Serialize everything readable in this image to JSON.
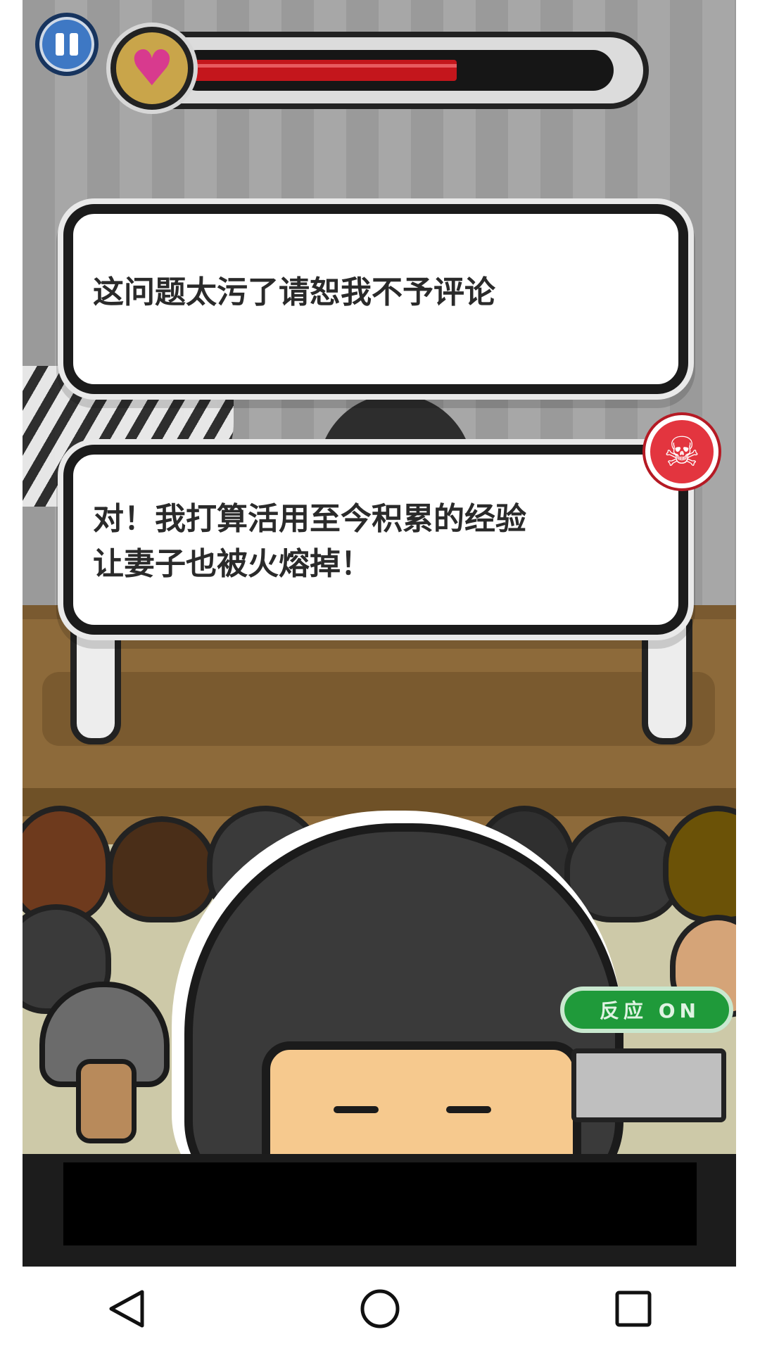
{
  "health": {
    "fraction": 0.64,
    "icon": "heart-icon",
    "color": "#c4161c"
  },
  "dialogue": {
    "options": [
      {
        "text": "这问题太污了请恕我不予评论"
      },
      {
        "text": "对！我打算活用至今积累的经验\n让妻子也被火熔掉！",
        "badge_icon": "skull-icon"
      }
    ]
  },
  "reaction_toggle": {
    "label": "反应 ON"
  },
  "colors": {
    "accent_green": "#1f9a3a",
    "skull_red": "#e3353f",
    "pause_blue": "#3e78c4"
  },
  "nav": {
    "buttons": [
      "back-icon",
      "home-icon",
      "recents-icon"
    ]
  }
}
